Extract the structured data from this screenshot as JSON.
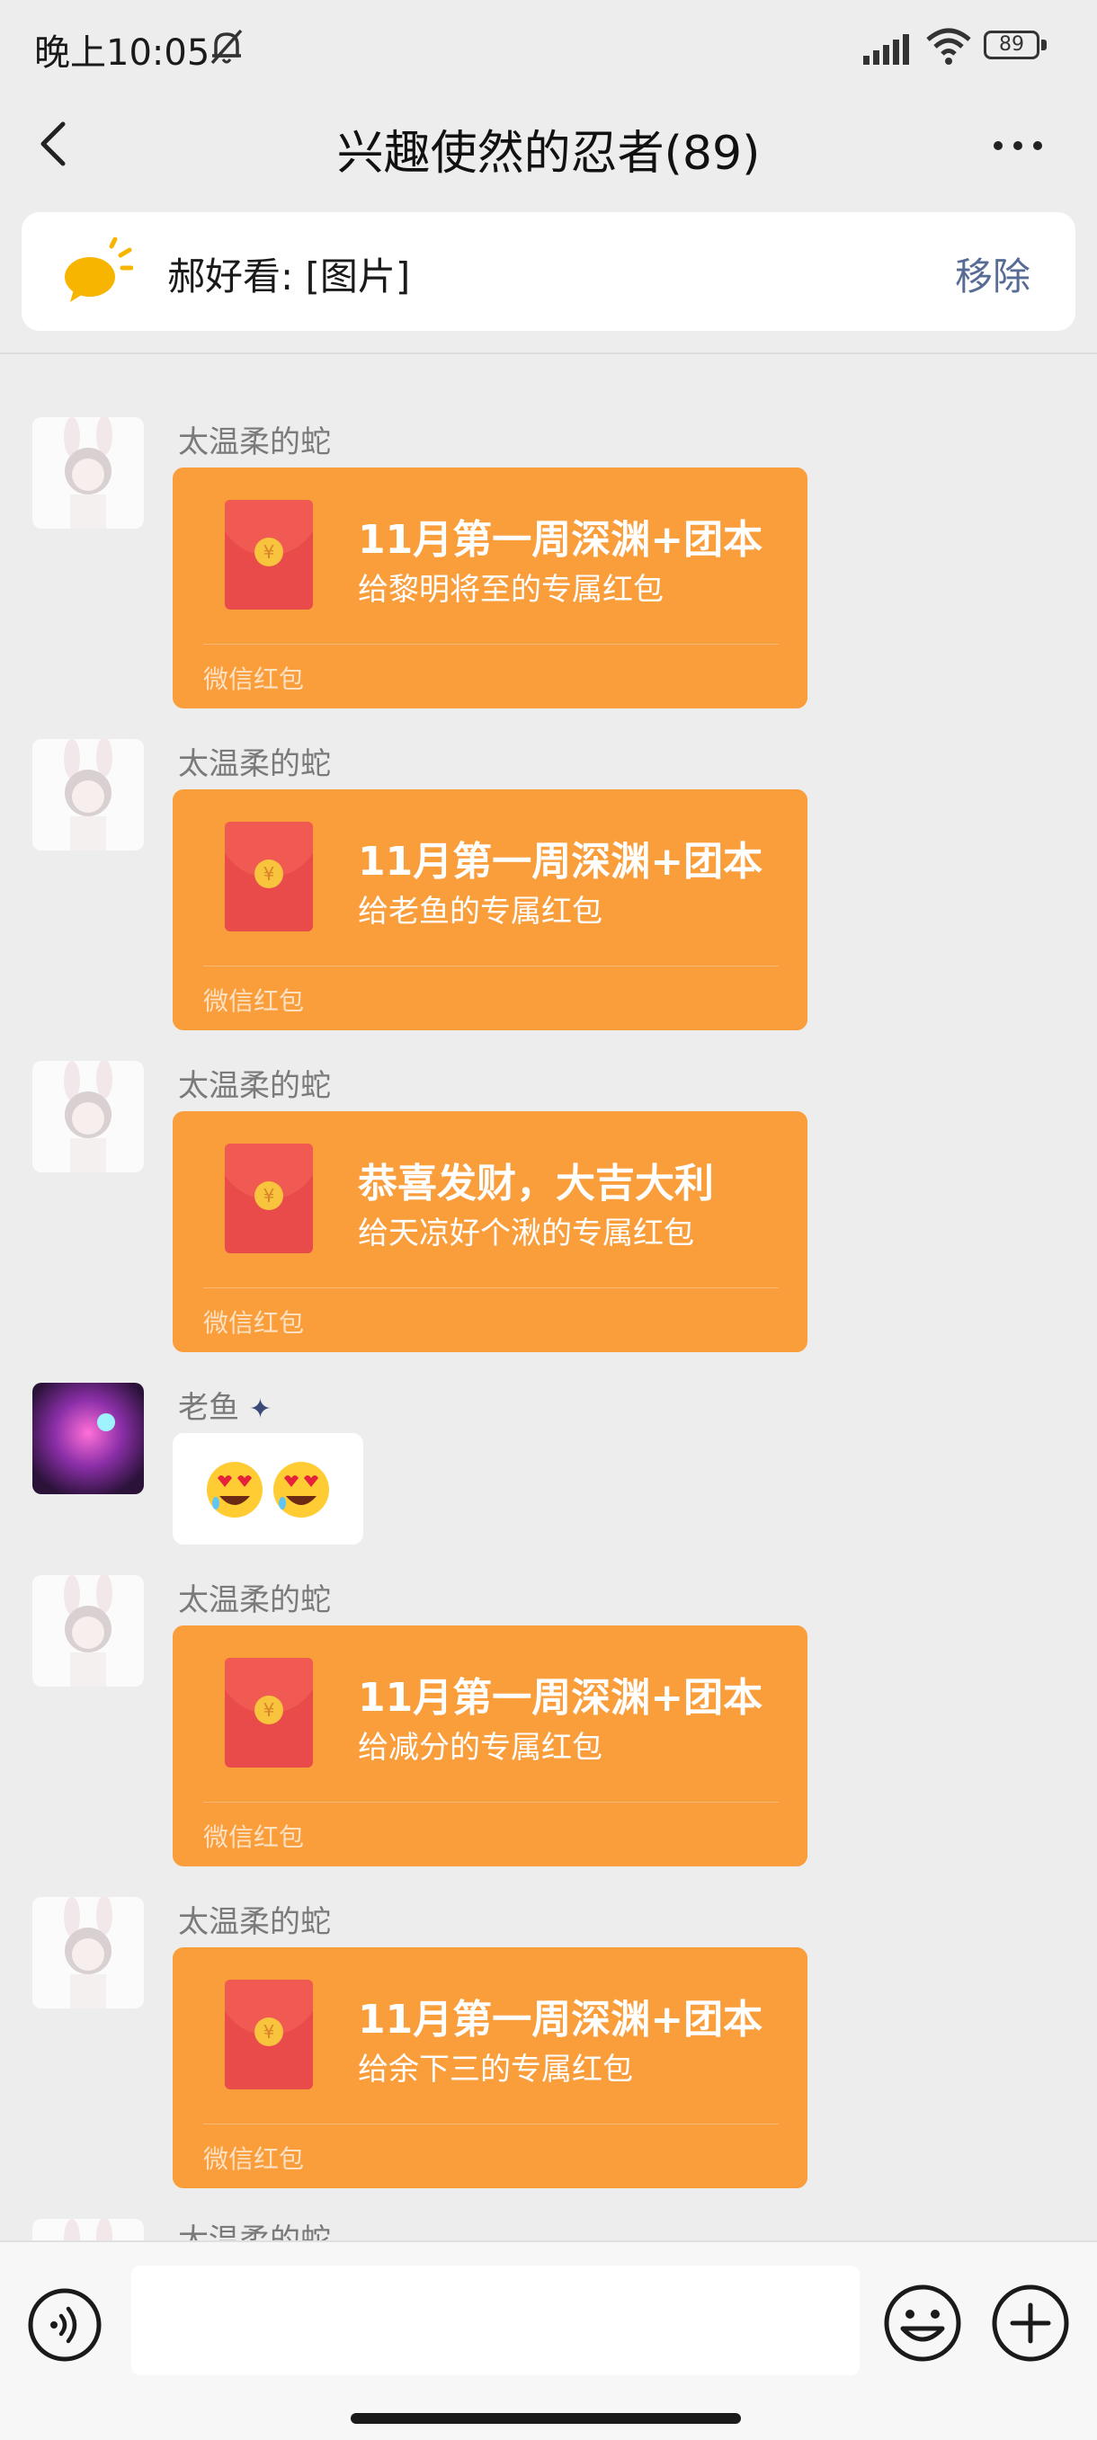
{
  "status_bar": {
    "time": "晚上10:05",
    "battery": "89"
  },
  "header": {
    "title": "兴趣使然的忍者(89)"
  },
  "pinned": {
    "text": "郝好看: [图片]",
    "remove_label": "移除"
  },
  "messages": [
    {
      "sender": "太温柔的蛇",
      "title": "11月第一周深渊+团本",
      "subtitle": "给黎明将至的专属红包",
      "footer": "微信红包"
    },
    {
      "sender": "太温柔的蛇",
      "title": "11月第一周深渊+团本",
      "subtitle": "给老鱼的专属红包",
      "footer": "微信红包"
    },
    {
      "sender": "太温柔的蛇",
      "title": "恭喜发财，大吉大利",
      "subtitle": "给天凉好个湫的专属红包",
      "footer": "微信红包"
    },
    {
      "sender": "老鱼",
      "emoji": "😍😍"
    },
    {
      "sender": "太温柔的蛇",
      "title": "11月第一周深渊+团本",
      "subtitle": "给减分的专属红包",
      "footer": "微信红包"
    },
    {
      "sender": "太温柔的蛇",
      "title": "11月第一周深渊+团本",
      "subtitle": "给余下三的专属红包",
      "footer": "微信红包"
    },
    {
      "sender": "太温柔的蛇"
    }
  ],
  "input": {
    "placeholder": ""
  },
  "colors": {
    "red_packet": "#fa9d3b",
    "link": "#576b95",
    "background": "#ededed"
  }
}
